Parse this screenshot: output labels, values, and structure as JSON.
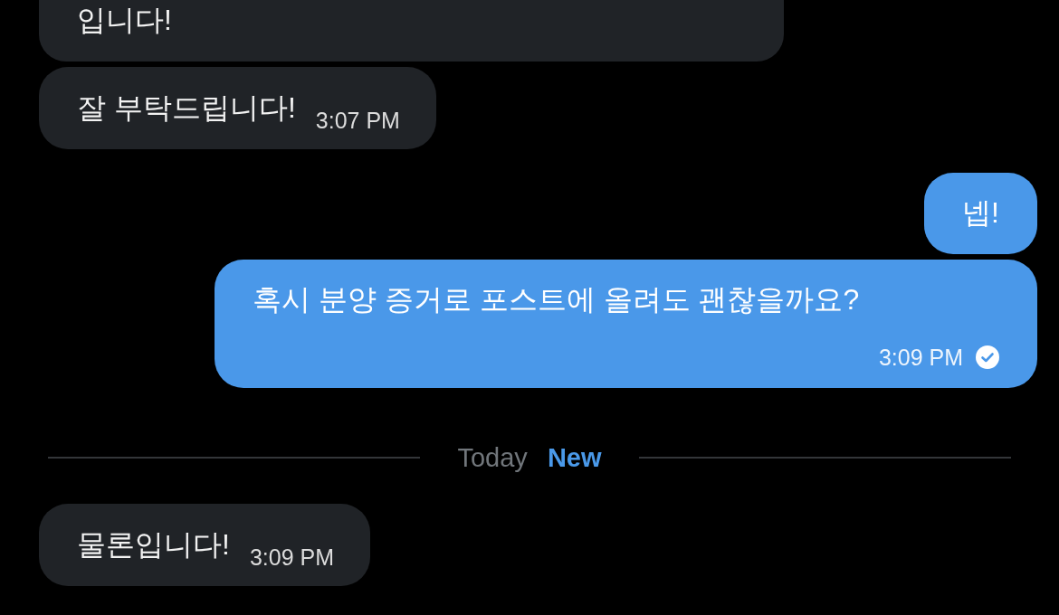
{
  "messages": [
    {
      "kind": "received",
      "text": "입니다!",
      "cut_top": true
    },
    {
      "kind": "received",
      "text": "잘 부탁드립니다!",
      "time": "3:07 PM"
    },
    {
      "kind": "sent",
      "text": "넵!"
    },
    {
      "kind": "sent",
      "text": "혹시 분양 증거로 포스트에 올려도 괜찮을까요?",
      "time": "3:09 PM",
      "seen": true
    },
    {
      "kind": "divider",
      "label": "Today",
      "badge": "New"
    },
    {
      "kind": "received",
      "text": "물론입니다!",
      "time": "3:09 PM"
    }
  ]
}
